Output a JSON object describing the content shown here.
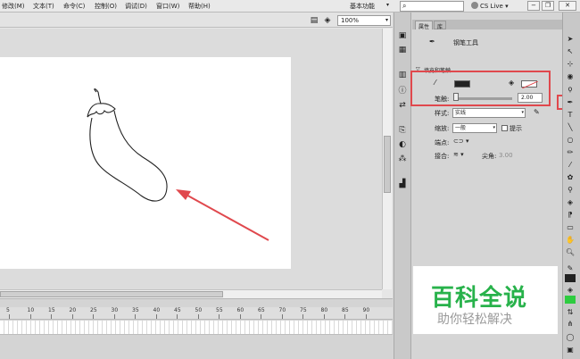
{
  "menu": {
    "items": [
      "修改(M)",
      "文本(T)",
      "命令(C)",
      "控制(O)",
      "调试(D)",
      "窗口(W)",
      "帮助(H)"
    ],
    "workspace": "基本功能",
    "search_icon": "search-icon",
    "cs_live": "CS Live"
  },
  "toolbar": {
    "zoom": "100%"
  },
  "timeline": {
    "ticks": [
      "5",
      "10",
      "15",
      "20",
      "25",
      "30",
      "35",
      "40",
      "45",
      "50",
      "55",
      "60",
      "65",
      "70",
      "75",
      "80",
      "85",
      "90"
    ]
  },
  "properties": {
    "tabs": [
      "属性",
      "库"
    ],
    "tool_name": "钢笔工具",
    "section": "填充和笔触",
    "stroke_label": "笔触:",
    "stroke_value": "2.00",
    "style_label": "样式:",
    "style_value": "实线",
    "scale_label": "缩放:",
    "scale_value": "一般",
    "hint_label": "提示",
    "cap_label": "端点:",
    "join_label": "接合:",
    "miter_label": "尖角:",
    "miter_value": "3.00"
  },
  "watermark": {
    "title": "百科全说",
    "subtitle": "助你轻松解决"
  },
  "colors": {
    "stroke_color": "#222222",
    "accent_green": "#28b24b",
    "annotation_red": "#e0484d"
  }
}
